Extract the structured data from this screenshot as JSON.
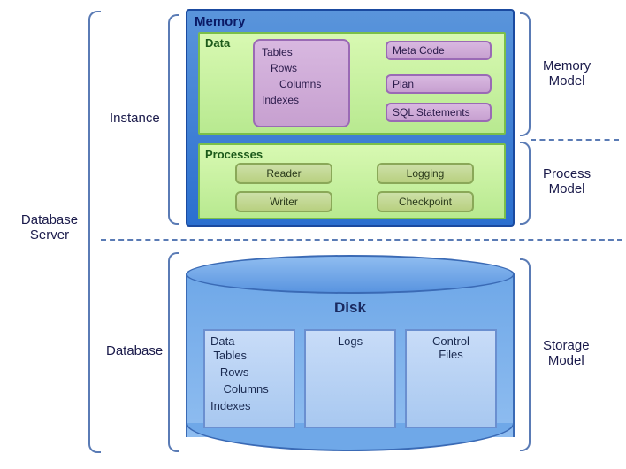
{
  "labels": {
    "dbServer": "Database\nServer",
    "instance": "Instance",
    "database": "Database",
    "memoryModel": "Memory\nModel",
    "processModel": "Process\nModel",
    "storageModel": "Storage\nModel"
  },
  "memory": {
    "title": "Memory",
    "data": {
      "title": "Data",
      "tree": "Tables\n   Rows\n      Columns\nIndexes",
      "metaCode": "Meta Code",
      "plan": "Plan",
      "sql": "SQL Statements"
    },
    "processes": {
      "title": "Processes",
      "reader": "Reader",
      "writer": "Writer",
      "logging": "Logging",
      "checkpoint": "Checkpoint"
    }
  },
  "disk": {
    "title": "Disk",
    "data": {
      "heading": "Data",
      "tree": " Tables\n   Rows\n    Columns\nIndexes"
    },
    "logs": "Logs",
    "control": "Control\nFiles"
  }
}
